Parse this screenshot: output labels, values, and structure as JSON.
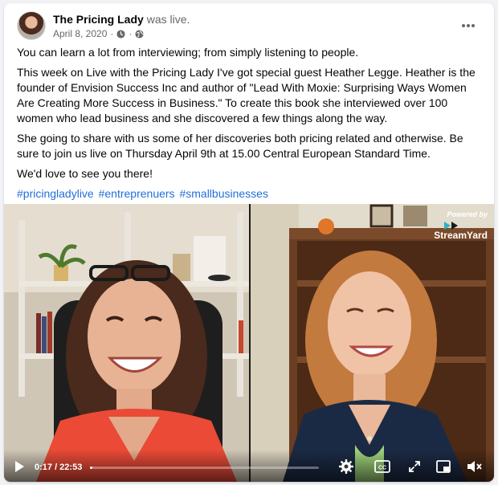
{
  "post": {
    "page_name": "The Pricing Lady",
    "action": "was live.",
    "date": "April 8, 2020",
    "separator": "·",
    "icons": [
      "avatar",
      "clock-icon",
      "globe-icon",
      "more-options-icon"
    ]
  },
  "content": {
    "paragraphs": [
      "You can learn a lot from interviewing; from simply listening to people.",
      "This week on Live with the Pricing Lady I've got special guest Heather Legge. Heather is the founder of Envision Success Inc and author of \"Lead With Moxie: Surprising Ways Women Are Creating More Success in Business.\"  To create this book she interviewed over 100 women who lead business and she discovered a few things along the way.",
      "She going to share with us some of her discoveries both pricing related and otherwise. Be sure to join us live on Thursday April 9th at 15.00 Central European Standard Time.",
      "We'd love to see you there!"
    ],
    "hashtags": [
      "#pricingladylive",
      "#entreprenuers",
      "#smallbusinesses"
    ]
  },
  "video": {
    "watermark_powered": "Powered by",
    "watermark_name": "StreamYard",
    "time_display": "0:17 / 22:53",
    "progress": 0.012,
    "icons": [
      "play-icon",
      "settings-icon",
      "captions-icon",
      "fullscreen-icon",
      "pip-icon",
      "volume-icon"
    ]
  }
}
